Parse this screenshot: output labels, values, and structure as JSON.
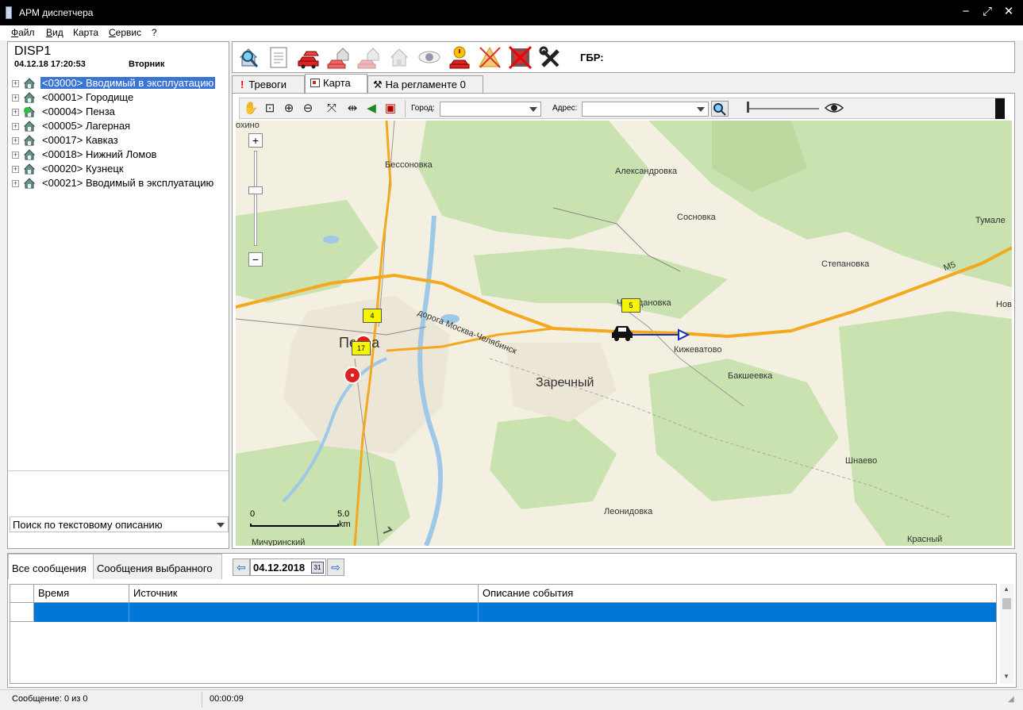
{
  "window": {
    "title": "АРМ диспетчера",
    "minimize": "−",
    "restore": "⤢",
    "close": "✕"
  },
  "menu": [
    {
      "label": "Файл",
      "key": "Ф",
      "rest": "айл"
    },
    {
      "label": "Вид",
      "key": "В",
      "rest": "ид"
    },
    {
      "label": "Карта",
      "key": "",
      "rest": "Карта"
    },
    {
      "label": "Сервис",
      "key": "С",
      "rest": "ервис"
    },
    {
      "label": "?",
      "key": "",
      "rest": "?"
    }
  ],
  "left": {
    "operator": "DISP1",
    "datetime": "04.12.18 17:20:53",
    "weekday": "Вторник",
    "tree": [
      {
        "code": "<03000>",
        "name": "Вводимый в эксплуатацию",
        "selected": true,
        "icon": "house-icon"
      },
      {
        "code": "<00001>",
        "name": "Городище",
        "selected": false,
        "icon": "house-icon"
      },
      {
        "code": "<00004>",
        "name": "Пенза",
        "selected": false,
        "icon": "house-green-icon"
      },
      {
        "code": "<00005>",
        "name": "Лагерная",
        "selected": false,
        "icon": "house-icon"
      },
      {
        "code": "<00017>",
        "name": "Кавказ",
        "selected": false,
        "icon": "house-icon"
      },
      {
        "code": "<00018>",
        "name": "Нижний Ломов",
        "selected": false,
        "icon": "house-icon"
      },
      {
        "code": "<00020>",
        "name": "Кузнецк",
        "selected": false,
        "icon": "house-icon"
      },
      {
        "code": "<00021>",
        "name": "Вводимый в эксплуатацию",
        "selected": false,
        "icon": "house-icon"
      }
    ],
    "search_label": "Поиск по текстовому описанию"
  },
  "toolbar": {
    "buttons": [
      "search-house-icon",
      "report-icon",
      "cars-icon",
      "house-car-icon",
      "house-car-faded-icon",
      "house-faded-icon",
      "eye-icon",
      "alarm-car-icon",
      "warning-disabled-icon",
      "cancel-icon",
      "tools-icon"
    ],
    "gbr_label": "ГБР:"
  },
  "tabs": [
    {
      "label": "Тревоги",
      "icon": "exclamation-icon"
    },
    {
      "label": "Карта",
      "icon": "map-icon",
      "active": true
    },
    {
      "label": "На регламенте 0",
      "icon": "wrench-icon"
    }
  ],
  "map_toolbar": {
    "city_label": "Город:",
    "city_value": "",
    "address_label": "Адрес:",
    "address_value": ""
  },
  "map": {
    "towns": [
      {
        "name": "Бессоновка"
      },
      {
        "name": "Александровка"
      },
      {
        "name": "Сосновка"
      },
      {
        "name": "Тумале"
      },
      {
        "name": "Степановка"
      },
      {
        "name": "Чемодановка"
      },
      {
        "name": "Кижеватово"
      },
      {
        "name": "Бакшеевка"
      },
      {
        "name": "Заречный"
      },
      {
        "name": "Пенза"
      },
      {
        "name": "Шнаево"
      },
      {
        "name": "Леонидовка"
      },
      {
        "name": "Красный"
      },
      {
        "name": "Мичуринский"
      },
      {
        "name": "охино"
      },
      {
        "name": "Нов"
      }
    ],
    "road_label": "дорога Москва-Челябинск",
    "road_m5": "М5",
    "markers": [
      {
        "label": "4"
      },
      {
        "label": "17"
      },
      {
        "label": "5"
      }
    ],
    "scale": {
      "zero": "0",
      "max": "5.0",
      "unit": "km"
    },
    "zoom_in": "+",
    "zoom_out": "−"
  },
  "bottom": {
    "tabs": [
      "Все сообщения",
      "Сообщения выбранного"
    ],
    "date": "04.12.2018",
    "calendar_day": "31",
    "columns": [
      "Время",
      "Источник",
      "Описание события"
    ]
  },
  "status": {
    "message": "Сообщение: 0 из 0",
    "timer": "00:00:09"
  },
  "colors": {
    "selection": "#3a75d6",
    "row_selected": "#0078d7",
    "road": "#f4a81d",
    "marker_red": "#e02020",
    "marker_yellow": "#f5f500"
  }
}
